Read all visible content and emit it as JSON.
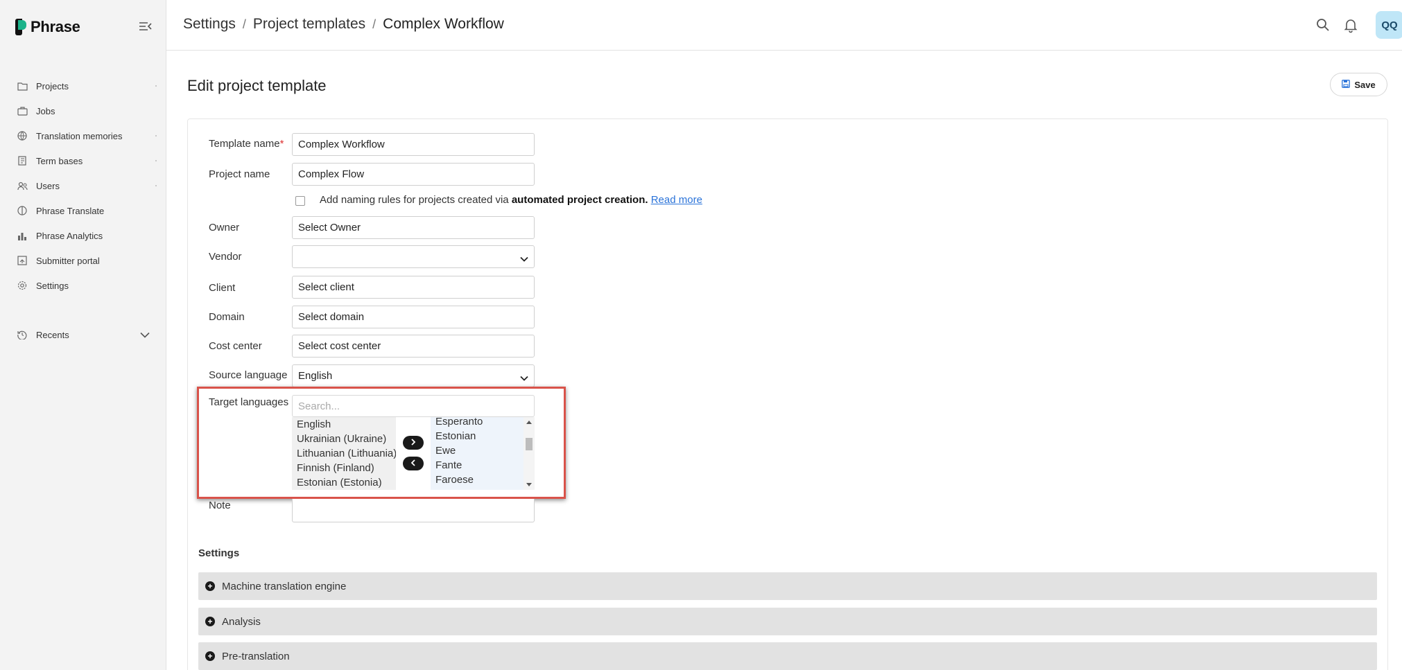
{
  "app": {
    "name": "Phrase"
  },
  "sidebar": {
    "items": [
      {
        "label": "Projects",
        "icon": "folder-icon"
      },
      {
        "label": "Jobs",
        "icon": "briefcase-icon"
      },
      {
        "label": "Translation memories",
        "icon": "globe-icon"
      },
      {
        "label": "Term bases",
        "icon": "book-icon"
      },
      {
        "label": "Users",
        "icon": "users-icon"
      },
      {
        "label": "Phrase Translate",
        "icon": "phrase-translate-icon"
      },
      {
        "label": "Phrase Analytics",
        "icon": "bar-chart-icon"
      },
      {
        "label": "Submitter portal",
        "icon": "portal-icon"
      },
      {
        "label": "Settings",
        "icon": "gear-icon"
      }
    ],
    "recents_label": "Recents"
  },
  "header": {
    "breadcrumb": [
      "Settings",
      "Project templates",
      "Complex Workflow"
    ],
    "separator": "/",
    "avatar_initials": "QQ"
  },
  "page": {
    "title": "Edit project template",
    "save_label": "Save"
  },
  "form": {
    "template_name": {
      "label": "Template name",
      "required_mark": "*",
      "value": "Complex Workflow"
    },
    "project_name": {
      "label": "Project name",
      "value": "Complex Flow"
    },
    "naming_rules": {
      "text": "Add naming rules for projects created via ",
      "bold": "automated project creation.",
      "link": "Read more",
      "checked": false
    },
    "owner": {
      "label": "Owner",
      "value": "Select Owner"
    },
    "vendor": {
      "label": "Vendor",
      "value": ""
    },
    "client": {
      "label": "Client",
      "value": "Select client"
    },
    "domain": {
      "label": "Domain",
      "value": "Select domain"
    },
    "cost_center": {
      "label": "Cost center",
      "value": "Select cost center"
    },
    "source_language": {
      "label": "Source language",
      "value": "English"
    },
    "target_languages": {
      "label": "Target languages",
      "search_placeholder": "Search...",
      "selected": [
        "English",
        "Ukrainian (Ukraine)",
        "Lithuanian (Lithuania)",
        "Finnish (Finland)",
        "Estonian (Estonia)"
      ],
      "available": [
        "Esperanto",
        "Estonian",
        "Ewe",
        "Fante",
        "Faroese"
      ]
    },
    "note": {
      "label": "Note",
      "value": ""
    }
  },
  "settings": {
    "title": "Settings",
    "sections": [
      "Machine translation engine",
      "Analysis",
      "Pre-translation"
    ]
  },
  "colors": {
    "highlight": "#d9534a",
    "brand_green": "#1bb38a",
    "link": "#2a73d9"
  }
}
